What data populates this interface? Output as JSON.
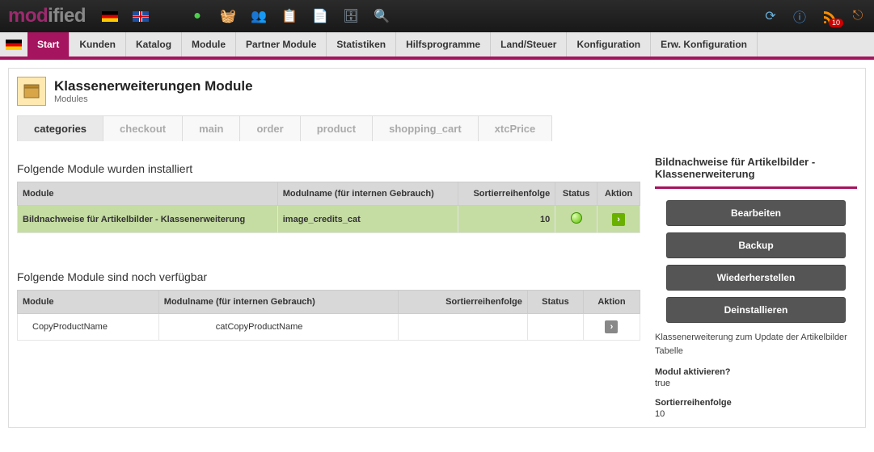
{
  "logo": {
    "left": "mod",
    "right": "ified"
  },
  "top_icons": [
    "flag-de",
    "flag-uk",
    "globe",
    "cart",
    "users",
    "clipboard",
    "copy",
    "database",
    "search"
  ],
  "top_right": [
    "refresh",
    "info",
    "rss",
    "exit"
  ],
  "rss_count": "10",
  "nav": [
    {
      "label": "Start",
      "active": true
    },
    {
      "label": "Kunden"
    },
    {
      "label": "Katalog"
    },
    {
      "label": "Module"
    },
    {
      "label": "Partner Module"
    },
    {
      "label": "Statistiken"
    },
    {
      "label": "Hilfsprogramme"
    },
    {
      "label": "Land/Steuer"
    },
    {
      "label": "Konfiguration"
    },
    {
      "label": "Erw. Konfiguration"
    }
  ],
  "page_header": {
    "title": "Klassenerweiterungen Module",
    "subtitle": "Modules"
  },
  "subtabs": [
    {
      "label": "categories",
      "active": true
    },
    {
      "label": "checkout"
    },
    {
      "label": "main"
    },
    {
      "label": "order"
    },
    {
      "label": "product"
    },
    {
      "label": "shopping_cart"
    },
    {
      "label": "xtcPrice"
    }
  ],
  "section_installed": "Folgende Module wurden installiert",
  "section_available": "Folgende Module sind noch verfügbar",
  "columns": {
    "module": "Module",
    "name": "Modulname (für internen Gebrauch)",
    "sort": "Sortierreihenfolge",
    "status": "Status",
    "action": "Aktion"
  },
  "installed_rows": [
    {
      "module": "Bildnachweise für Artikelbilder - Klassenerweiterung",
      "name": "image_credits_cat",
      "sort": "10",
      "status": "ok",
      "selected": true
    }
  ],
  "available_rows": [
    {
      "module": "CopyProductName",
      "name": "catCopyProductName",
      "sort": "",
      "status": ""
    }
  ],
  "side": {
    "title": "Bildnachweise für Artikelbilder - Klassenerweiterung",
    "buttons": [
      "Bearbeiten",
      "Backup",
      "Wiederherstellen",
      "Deinstallieren"
    ],
    "description": "Klassenerweiterung zum Update der Artikelbilder Tabelle",
    "activate_label": "Modul aktivieren?",
    "activate_value": "true",
    "sort_label": "Sortierreihenfolge",
    "sort_value": "10"
  }
}
